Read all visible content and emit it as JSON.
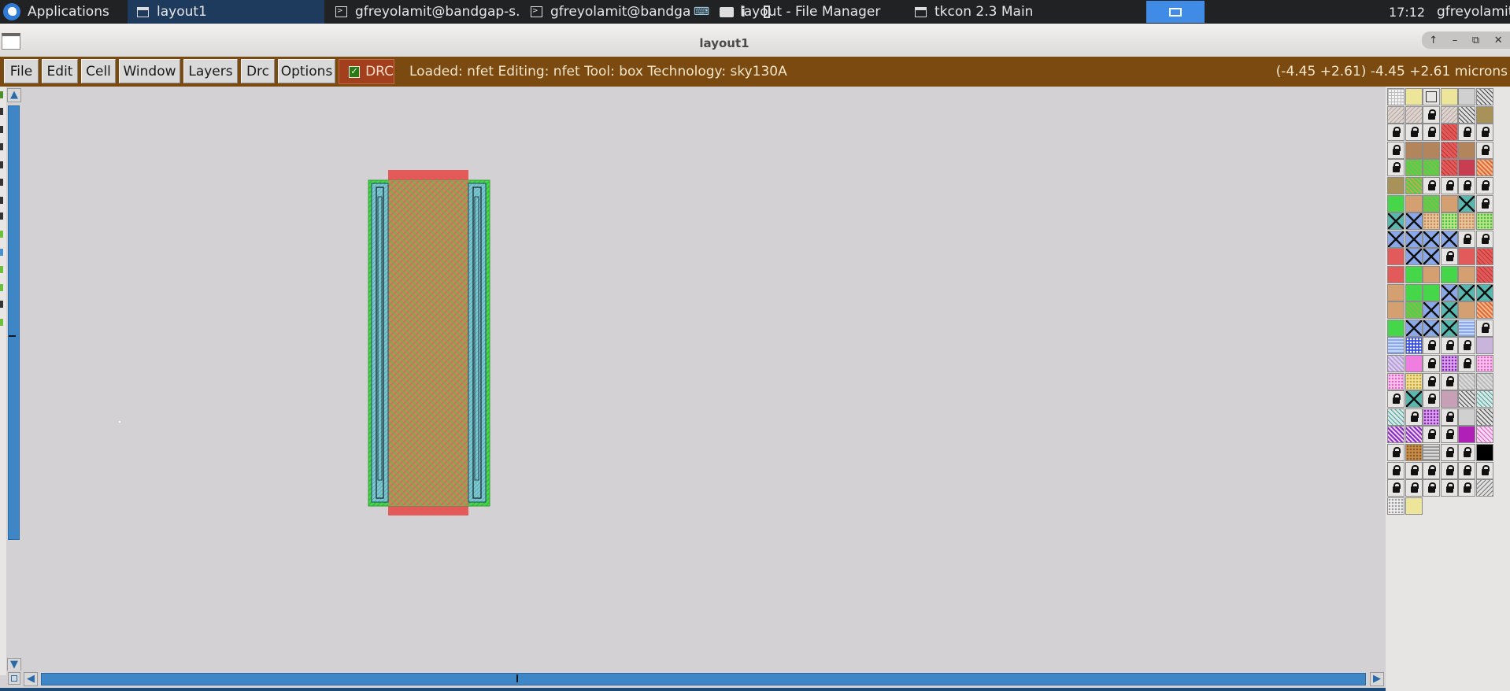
{
  "taskbar": {
    "applications_label": "Applications",
    "tasks": [
      {
        "label": "layout1",
        "icon": "window-icon",
        "active": true
      },
      {
        "label": "gfreyolamit@bandgap-s...",
        "icon": "terminal-icon",
        "active": false
      },
      {
        "label": "gfreyolamit@bandgap-",
        "icon": "terminal-icon",
        "active": false
      },
      {
        "label": "layout - File Manager",
        "icon": "folder-icon",
        "active": false
      },
      {
        "label": "tkcon 2.3 Main",
        "icon": "window-icon",
        "active": false
      }
    ],
    "clock": "17:12",
    "user": "gfreyolamit"
  },
  "window": {
    "title": "layout1",
    "buttons": [
      "↑",
      "–",
      "⧉",
      "✕"
    ]
  },
  "menubar": {
    "menus": [
      "File",
      "Edit",
      "Cell",
      "Window",
      "Layers",
      "Drc",
      "Options"
    ],
    "drc_label": "DRC",
    "drc_checked": true,
    "status": "Loaded: nfet Editing: nfet Tool: box  Technology: sky130A",
    "coords": "(-4.45 +2.61) -4.45 +2.61 microns"
  },
  "layout": {
    "cell": "nfet",
    "colors": {
      "diffusion": "#45d64a",
      "poly": "#e25a5a",
      "contact": "#7bc6cf",
      "background": "#d4d1d4"
    }
  },
  "palette": {
    "layer_styles": [
      [
        "grid",
        "pale-yellow",
        "outline",
        "pale-yellow",
        "gray",
        "stripes"
      ],
      [
        "hatch-gray",
        "hatch-gray",
        "lock",
        "hatch-gray",
        "stripes",
        "olive"
      ],
      [
        "lock",
        "lock",
        "lock",
        "red-hatch",
        "lock",
        "lock"
      ],
      [
        "lock",
        "brown",
        "brown",
        "red-hatch",
        "brown",
        "lock"
      ],
      [
        "lock",
        "green-hatch",
        "green-hatch",
        "red-hatch",
        "crimson",
        "orange-stripes"
      ],
      [
        "olive",
        "green-stripes",
        "lock",
        "lock",
        "lock",
        "lock"
      ],
      [
        "green",
        "tan",
        "green-hatch",
        "tan",
        "teal-cross",
        "lock"
      ],
      [
        "teal-cross",
        "blue-cross",
        "tan-dots",
        "green-dots",
        "tan-dots",
        "green-dots"
      ],
      [
        "blue-cross",
        "blue-cross",
        "blue-cross",
        "blue-cross",
        "lock",
        "lock"
      ],
      [
        "red",
        "blue-cross",
        "blue-cross",
        "lock",
        "red",
        "red-hatch"
      ],
      [
        "red",
        "green",
        "tan",
        "green",
        "tan",
        "red-hatch"
      ],
      [
        "tan",
        "green",
        "green",
        "blue-cross",
        "teal-cross",
        "teal-cross"
      ],
      [
        "tan",
        "green-hatch",
        "blue-cross",
        "teal-cross",
        "tan",
        "orange-stripes"
      ],
      [
        "green",
        "blue-cross",
        "blue-cross",
        "teal-cross",
        "lightblue-wave",
        "lock"
      ],
      [
        "lightblue-wave",
        "blue-dots",
        "lock",
        "lock",
        "lock",
        "lavender"
      ],
      [
        "lavender-hatch",
        "pink",
        "lock",
        "purple-dots",
        "lock",
        "pink-dots"
      ],
      [
        "pink-dots",
        "yellow-dots",
        "lock",
        "lock",
        "gray-hatch",
        "gray-hatch"
      ],
      [
        "lock",
        "teal-cross",
        "lock",
        "mauve",
        "stripes",
        "teal-stripes"
      ],
      [
        "teal-stripes",
        "lock",
        "purple-dots",
        "lock",
        "gray",
        "stripes"
      ],
      [
        "purple-stripes",
        "purple-stripes",
        "lock",
        "lock",
        "magenta",
        "pink-stripes"
      ],
      [
        "lock",
        "brown-dots",
        "gray-wave",
        "lock",
        "lock",
        "black"
      ],
      [
        "lock",
        "lock",
        "lock",
        "lock",
        "lock",
        "lock"
      ],
      [
        "lock",
        "lock",
        "lock",
        "lock",
        "lock",
        "gray-stripes"
      ],
      [
        "white-dots",
        "pale-yellow"
      ]
    ]
  }
}
